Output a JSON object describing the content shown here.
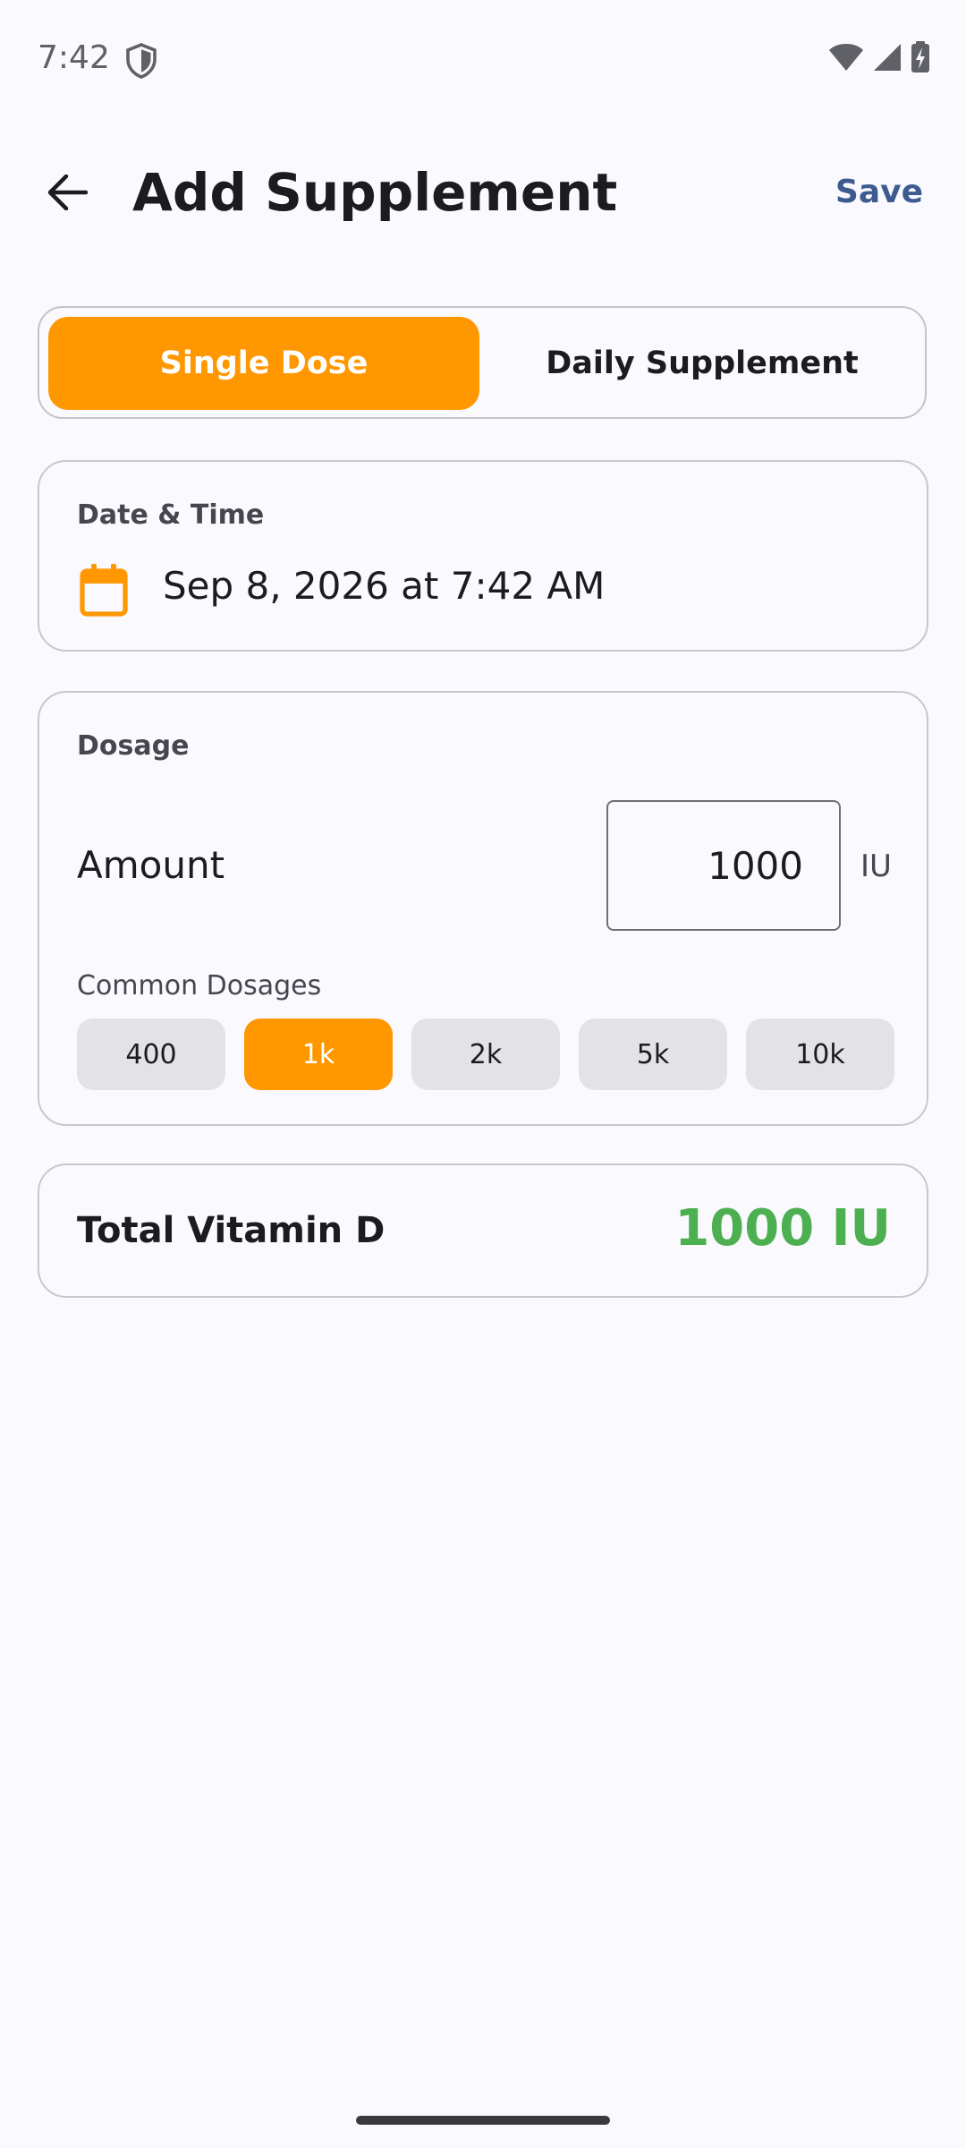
{
  "status_bar": {
    "time": "7:42"
  },
  "app_bar": {
    "title": "Add Supplement",
    "save_label": "Save"
  },
  "mode_toggle": {
    "options": [
      "Single Dose",
      "Daily Supplement"
    ],
    "selected": "Single Dose"
  },
  "date_time": {
    "label": "Date & Time",
    "value": "Sep 8, 2026 at 7:42 AM"
  },
  "dosage": {
    "label": "Dosage",
    "amount_label": "Amount",
    "amount_value": "1000",
    "unit": "IU",
    "common_label": "Common Dosages",
    "chips": [
      "400",
      "1k",
      "2k",
      "5k",
      "10k"
    ],
    "selected_chip": "1k"
  },
  "total": {
    "label": "Total Vitamin D",
    "value": "1000 IU"
  },
  "colors": {
    "accent": "#ff9800",
    "save": "#3e5b90",
    "total_value": "#4caf50",
    "background": "#f9f9fe"
  },
  "icons": [
    "back-arrow-icon",
    "calendar-icon",
    "shield-icon",
    "wifi-icon",
    "signal-icon",
    "battery-icon"
  ]
}
